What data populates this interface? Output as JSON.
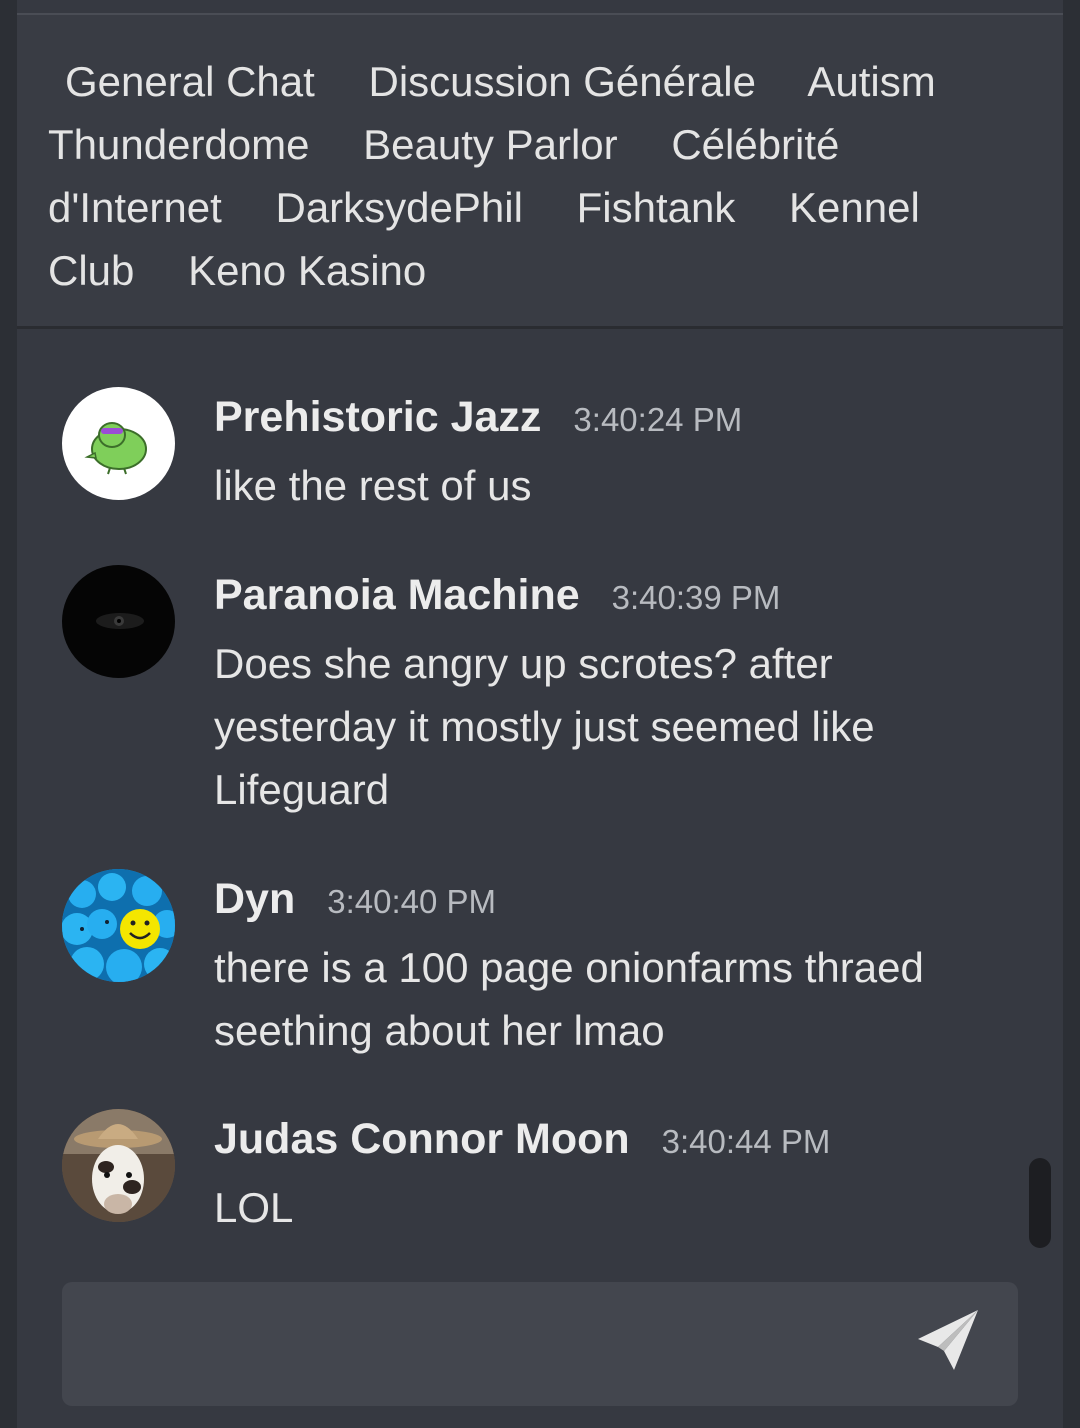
{
  "rooms": [
    "General Chat",
    "Discussion Générale",
    "Autism Thunderdome",
    "Beauty Parlor",
    "Célébrité d'Internet",
    "DarksydePhil",
    "Fishtank",
    "Kennel Club",
    "Keno Kasino"
  ],
  "messages": [
    {
      "author": "Prehistoric Jazz",
      "time": "3:40:24 PM",
      "text": "like the rest of us",
      "avatar": "green-bird-avatar"
    },
    {
      "author": "Paranoia Machine",
      "time": "3:40:39 PM",
      "text": "Does she angry up scrotes? after yesterday it mostly just seemed like Lifeguard",
      "avatar": "dark-eye-avatar"
    },
    {
      "author": "Dyn",
      "time": "3:40:40 PM",
      "text": "there is a 100 page onionfarms thraed seething about her lmao",
      "avatar": "smiley-crowd-avatar"
    },
    {
      "author": "Judas Connor Moon",
      "time": "3:40:44 PM",
      "text": "LOL",
      "avatar": "cow-hat-avatar"
    }
  ],
  "composer": {
    "placeholder": "",
    "value": "",
    "send_icon": "paper-plane-icon"
  },
  "colors": {
    "background": "#2c2f35",
    "panel": "#363941",
    "rooms_bar": "#393c44",
    "composer": "#43464e"
  }
}
